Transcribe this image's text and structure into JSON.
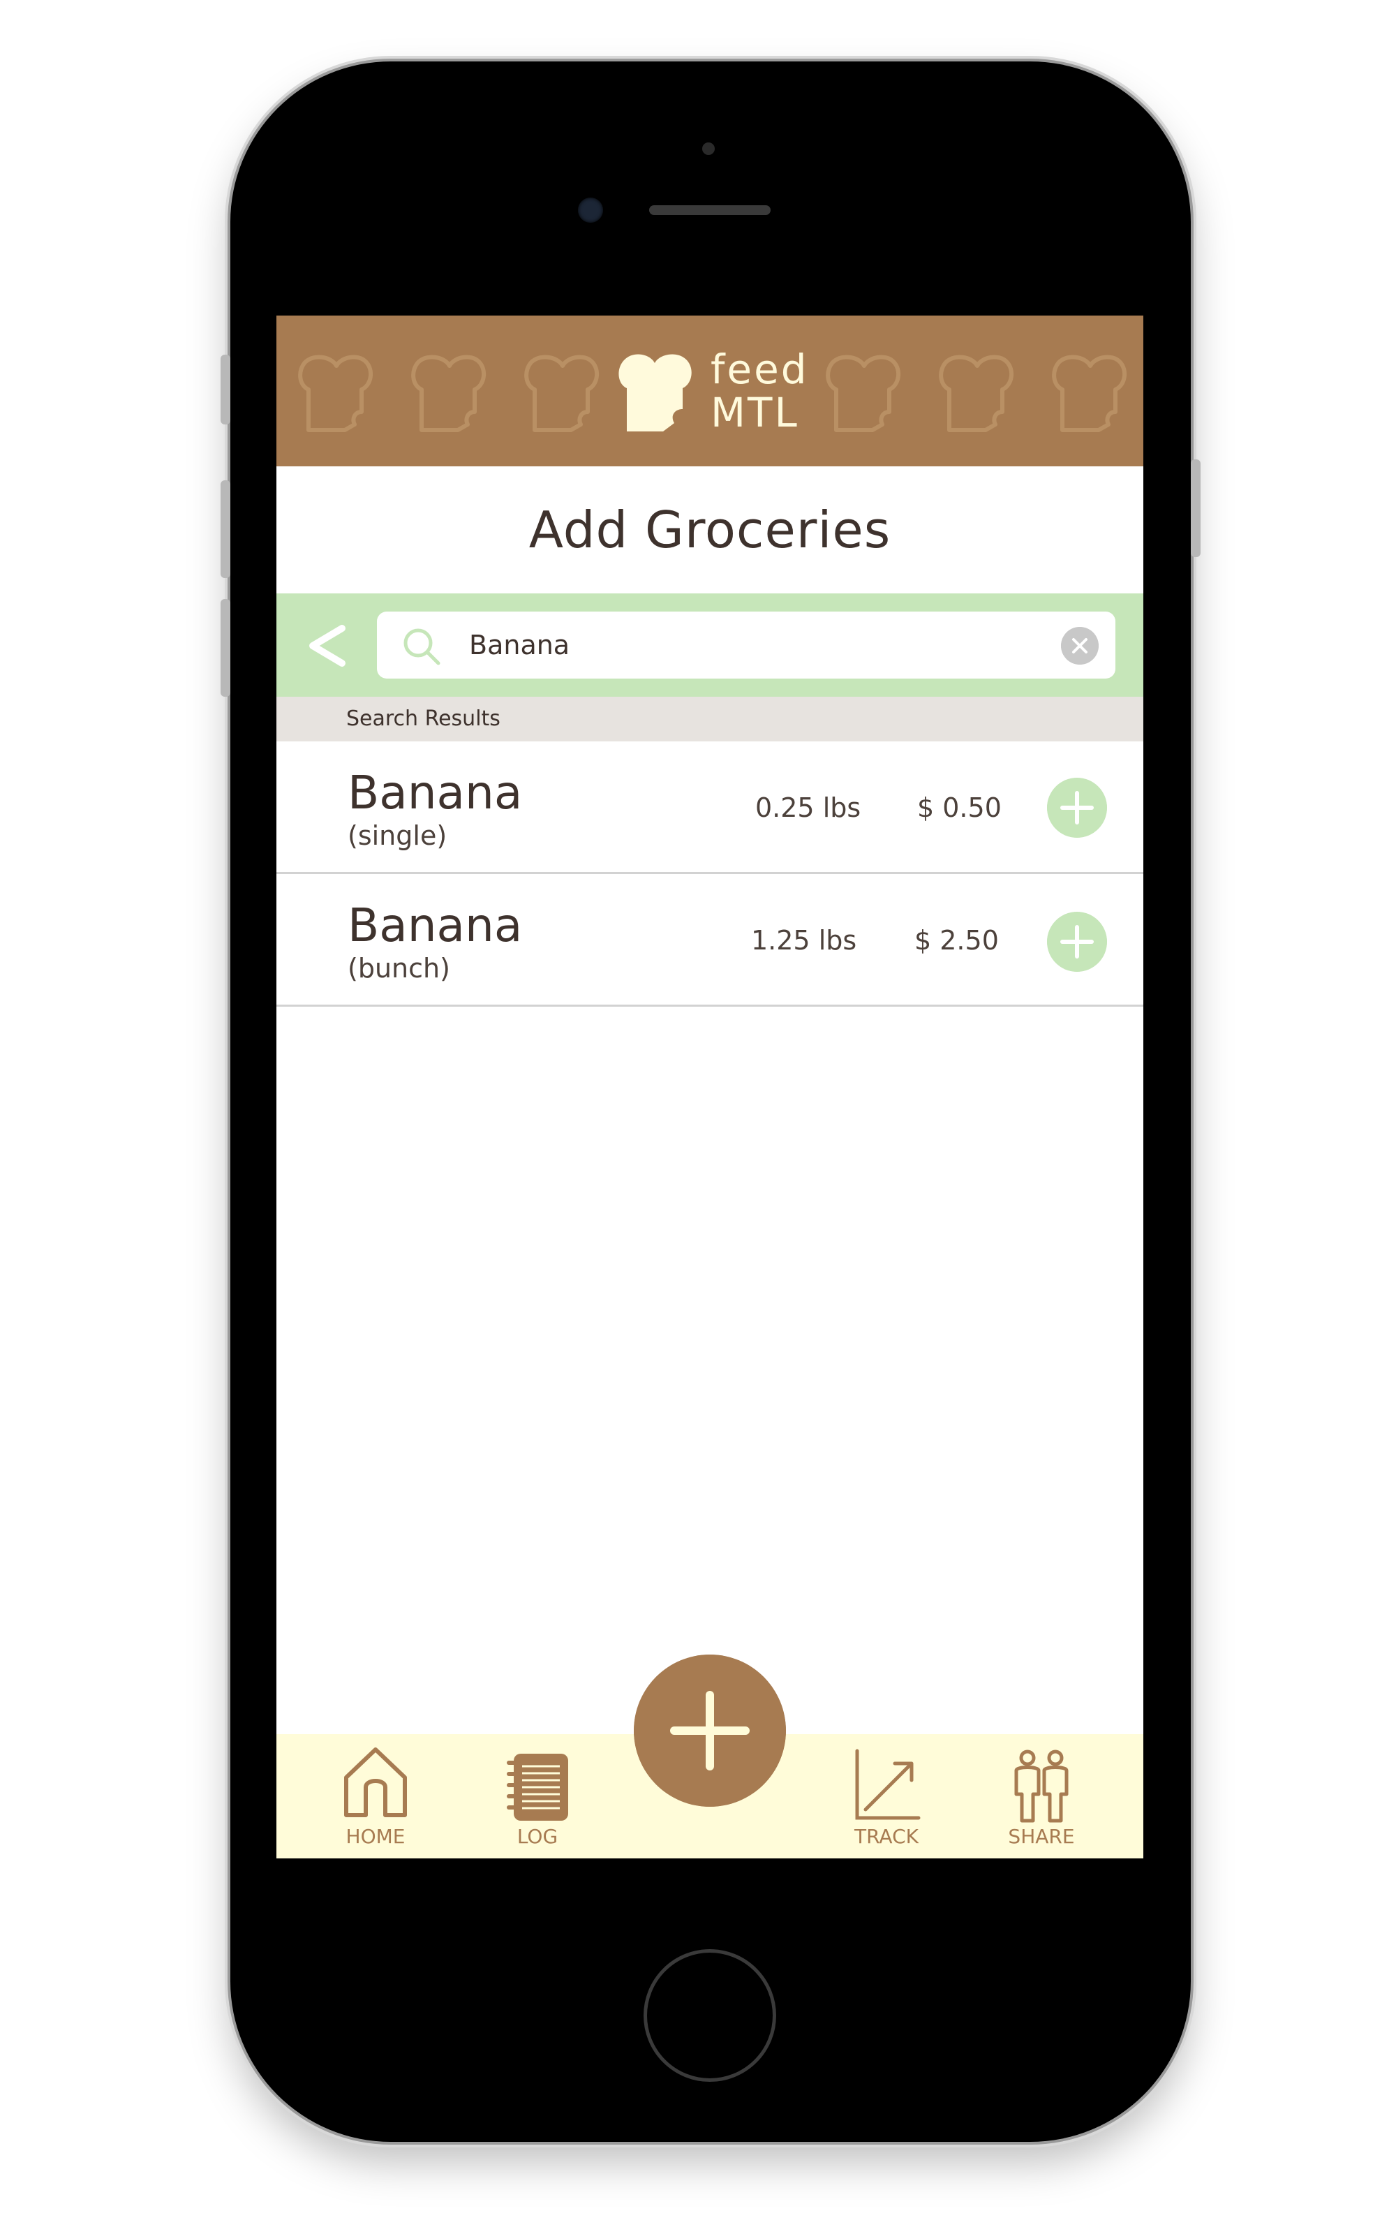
{
  "app": {
    "logo_line1": "feed",
    "logo_line2": "MTL"
  },
  "page": {
    "title": "Add Groceries"
  },
  "search": {
    "value": "Banana",
    "results_label": "Search Results"
  },
  "results": [
    {
      "name": "Banana",
      "variant": "(single)",
      "weight": "0.25 lbs",
      "price": "$ 0.50"
    },
    {
      "name": "Banana",
      "variant": "(bunch)",
      "weight": "1.25 lbs",
      "price": "$ 2.50"
    }
  ],
  "nav": {
    "home": "HOME",
    "log": "LOG",
    "track": "TRACK",
    "share": "SHARE"
  },
  "colors": {
    "brand_brown": "#a77b51",
    "accent_green": "#c6e6b9",
    "nav_cream": "#fffcd9",
    "text_dark": "#3e322d"
  },
  "icons": {
    "header": "bread-slice-icon",
    "back": "chevron-left-icon",
    "search": "search-icon",
    "clear": "clear-icon",
    "add": "plus-icon",
    "home": "home-icon",
    "log": "notebook-icon",
    "track": "chart-trend-icon",
    "share": "people-icon"
  }
}
